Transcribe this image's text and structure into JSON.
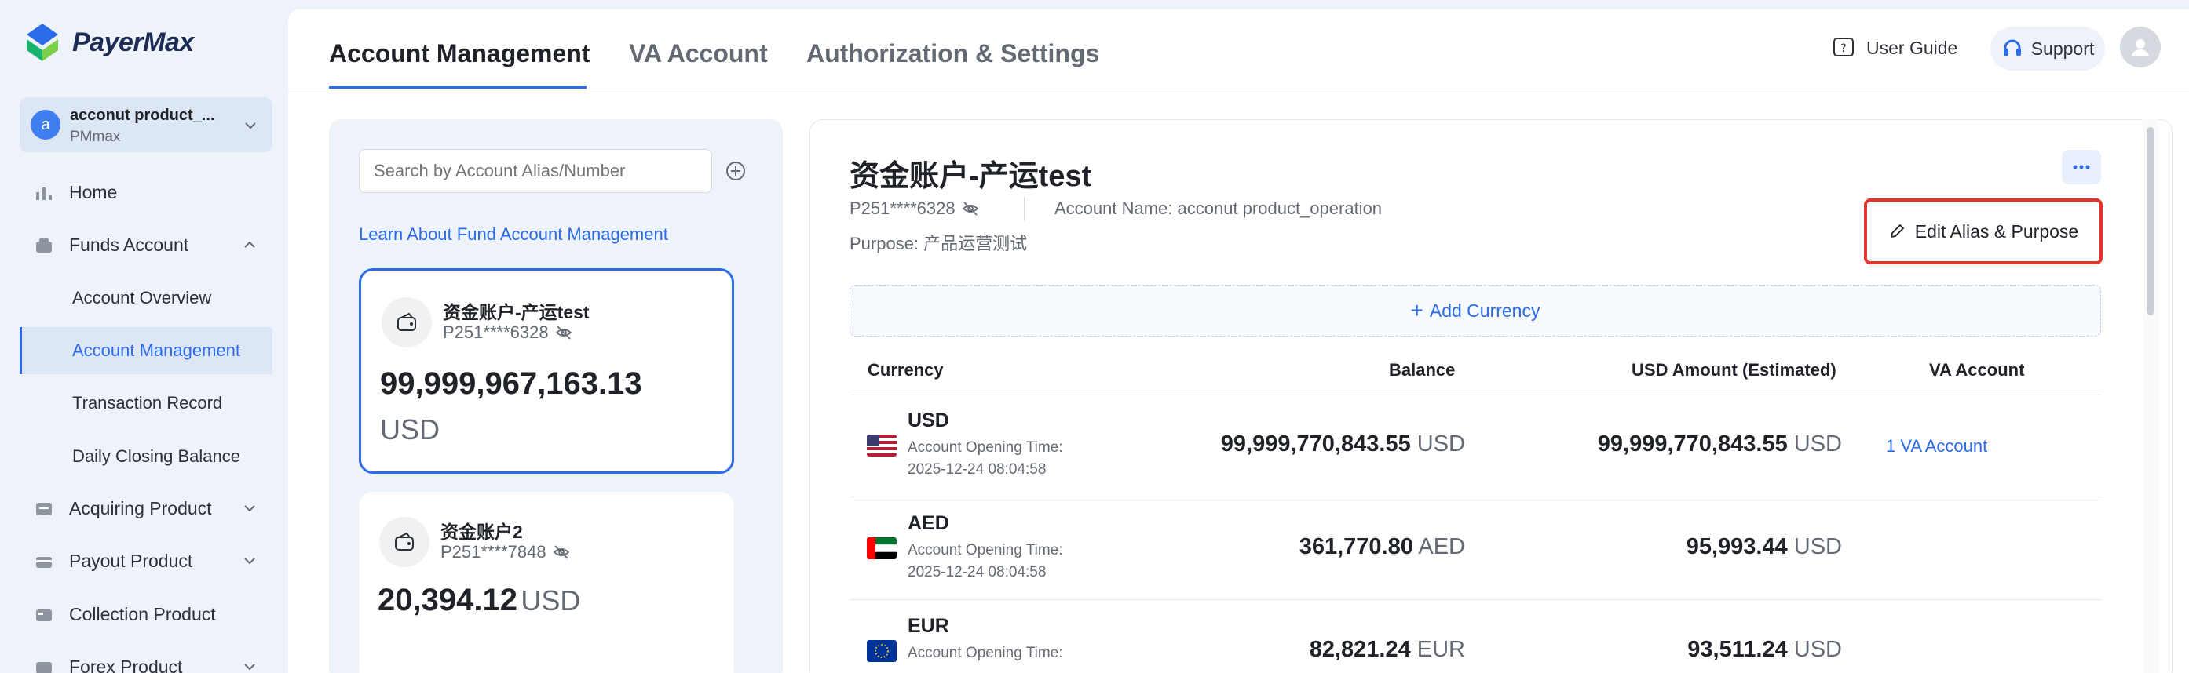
{
  "brand": {
    "name": "PayerMax"
  },
  "account_switcher": {
    "initial": "a",
    "name": "acconut product_...",
    "org": "PMmax"
  },
  "nav": {
    "home": "Home",
    "funds_account": "Funds Account",
    "account_overview": "Account Overview",
    "account_management": "Account Management",
    "transaction_record": "Transaction Record",
    "daily_closing_balance": "Daily Closing Balance",
    "acquiring_product": "Acquiring Product",
    "payout_product": "Payout Product",
    "collection_product": "Collection Product",
    "forex_product": "Forex Product"
  },
  "tabs": [
    {
      "label": "Account Management"
    },
    {
      "label": "VA Account"
    },
    {
      "label": "Authorization & Settings"
    }
  ],
  "header": {
    "user_guide": "User Guide",
    "support": "Support"
  },
  "list": {
    "search_placeholder": "Search by Account Alias/Number",
    "learn_link": "Learn About Fund Account Management",
    "cards": [
      {
        "name": "资金账户-产运test",
        "number": "P251****6328",
        "amount": "99,999,967,163.13",
        "currency": "USD"
      },
      {
        "name": "资金账户2",
        "number": "P251****7848",
        "amount": "20,394.12",
        "currency": "USD"
      }
    ]
  },
  "detail": {
    "title": "资金账户-产运test",
    "number": "P251****6328",
    "account_name": "Account Name: acconut product_operation",
    "purpose": "Purpose: 产品运营测试",
    "edit_button": "Edit Alias & Purpose",
    "add_currency": "Add Currency",
    "columns": {
      "currency": "Currency",
      "balance": "Balance",
      "usd_amount": "USD Amount (Estimated)",
      "va_account": "VA Account"
    },
    "rows": [
      {
        "code": "USD",
        "opening_label": "Account Opening Time:",
        "opening_time": "2025-12-24 08:04:58",
        "balance": "99,999,770,843.55",
        "balance_cur": "USD",
        "usd": "99,999,770,843.55",
        "usd_cur": "USD",
        "va": "1 VA Account"
      },
      {
        "code": "AED",
        "opening_label": "Account Opening Time:",
        "opening_time": "2025-12-24 08:04:58",
        "balance": "361,770.80",
        "balance_cur": "AED",
        "usd": "95,993.44",
        "usd_cur": "USD",
        "va": ""
      },
      {
        "code": "EUR",
        "opening_label": "Account Opening Time:",
        "opening_time": "",
        "balance": "82,821.24",
        "balance_cur": "EUR",
        "usd": "93,511.24",
        "usd_cur": "USD",
        "va": ""
      }
    ]
  },
  "colors": {
    "accent": "#2c6be8",
    "highlight_border": "#e5322d",
    "sidebar_bg": "#eef2f9"
  }
}
